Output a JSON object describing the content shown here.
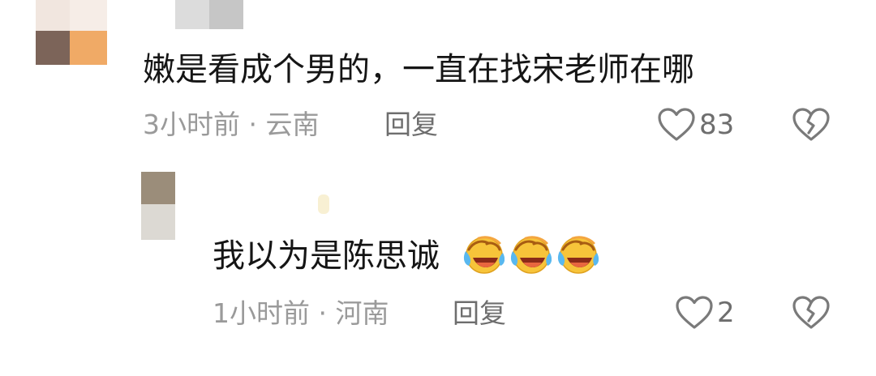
{
  "comments": [
    {
      "text": "嫩是看成个男的，一直在找宋老师在哪",
      "meta": "3小时前 · 云南",
      "reply_label": "回复",
      "likes": "83"
    },
    {
      "text": "我以为是陈思诚",
      "emojis": [
        "laugh-cry-emoji",
        "laugh-cry-emoji",
        "laugh-cry-emoji"
      ],
      "meta": "1小时前 · 河南",
      "reply_label": "回复",
      "likes": "2"
    }
  ],
  "colors": {
    "text": "#151515",
    "meta": "#9a9a9a",
    "action": "#6e6e6e"
  },
  "icons": {
    "like": "heart-outline-icon",
    "dislike": "broken-heart-icon"
  }
}
